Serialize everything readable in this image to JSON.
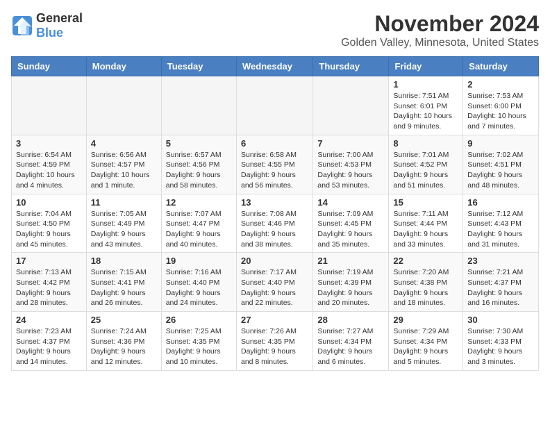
{
  "header": {
    "logo_general": "General",
    "logo_blue": "Blue",
    "month": "November 2024",
    "location": "Golden Valley, Minnesota, United States"
  },
  "weekdays": [
    "Sunday",
    "Monday",
    "Tuesday",
    "Wednesday",
    "Thursday",
    "Friday",
    "Saturday"
  ],
  "weeks": [
    [
      {
        "day": "",
        "info": ""
      },
      {
        "day": "",
        "info": ""
      },
      {
        "day": "",
        "info": ""
      },
      {
        "day": "",
        "info": ""
      },
      {
        "day": "",
        "info": ""
      },
      {
        "day": "1",
        "info": "Sunrise: 7:51 AM\nSunset: 6:01 PM\nDaylight: 10 hours and 9 minutes."
      },
      {
        "day": "2",
        "info": "Sunrise: 7:53 AM\nSunset: 6:00 PM\nDaylight: 10 hours and 7 minutes."
      }
    ],
    [
      {
        "day": "3",
        "info": "Sunrise: 6:54 AM\nSunset: 4:59 PM\nDaylight: 10 hours and 4 minutes."
      },
      {
        "day": "4",
        "info": "Sunrise: 6:56 AM\nSunset: 4:57 PM\nDaylight: 10 hours and 1 minute."
      },
      {
        "day": "5",
        "info": "Sunrise: 6:57 AM\nSunset: 4:56 PM\nDaylight: 9 hours and 58 minutes."
      },
      {
        "day": "6",
        "info": "Sunrise: 6:58 AM\nSunset: 4:55 PM\nDaylight: 9 hours and 56 minutes."
      },
      {
        "day": "7",
        "info": "Sunrise: 7:00 AM\nSunset: 4:53 PM\nDaylight: 9 hours and 53 minutes."
      },
      {
        "day": "8",
        "info": "Sunrise: 7:01 AM\nSunset: 4:52 PM\nDaylight: 9 hours and 51 minutes."
      },
      {
        "day": "9",
        "info": "Sunrise: 7:02 AM\nSunset: 4:51 PM\nDaylight: 9 hours and 48 minutes."
      }
    ],
    [
      {
        "day": "10",
        "info": "Sunrise: 7:04 AM\nSunset: 4:50 PM\nDaylight: 9 hours and 45 minutes."
      },
      {
        "day": "11",
        "info": "Sunrise: 7:05 AM\nSunset: 4:49 PM\nDaylight: 9 hours and 43 minutes."
      },
      {
        "day": "12",
        "info": "Sunrise: 7:07 AM\nSunset: 4:47 PM\nDaylight: 9 hours and 40 minutes."
      },
      {
        "day": "13",
        "info": "Sunrise: 7:08 AM\nSunset: 4:46 PM\nDaylight: 9 hours and 38 minutes."
      },
      {
        "day": "14",
        "info": "Sunrise: 7:09 AM\nSunset: 4:45 PM\nDaylight: 9 hours and 35 minutes."
      },
      {
        "day": "15",
        "info": "Sunrise: 7:11 AM\nSunset: 4:44 PM\nDaylight: 9 hours and 33 minutes."
      },
      {
        "day": "16",
        "info": "Sunrise: 7:12 AM\nSunset: 4:43 PM\nDaylight: 9 hours and 31 minutes."
      }
    ],
    [
      {
        "day": "17",
        "info": "Sunrise: 7:13 AM\nSunset: 4:42 PM\nDaylight: 9 hours and 28 minutes."
      },
      {
        "day": "18",
        "info": "Sunrise: 7:15 AM\nSunset: 4:41 PM\nDaylight: 9 hours and 26 minutes."
      },
      {
        "day": "19",
        "info": "Sunrise: 7:16 AM\nSunset: 4:40 PM\nDaylight: 9 hours and 24 minutes."
      },
      {
        "day": "20",
        "info": "Sunrise: 7:17 AM\nSunset: 4:40 PM\nDaylight: 9 hours and 22 minutes."
      },
      {
        "day": "21",
        "info": "Sunrise: 7:19 AM\nSunset: 4:39 PM\nDaylight: 9 hours and 20 minutes."
      },
      {
        "day": "22",
        "info": "Sunrise: 7:20 AM\nSunset: 4:38 PM\nDaylight: 9 hours and 18 minutes."
      },
      {
        "day": "23",
        "info": "Sunrise: 7:21 AM\nSunset: 4:37 PM\nDaylight: 9 hours and 16 minutes."
      }
    ],
    [
      {
        "day": "24",
        "info": "Sunrise: 7:23 AM\nSunset: 4:37 PM\nDaylight: 9 hours and 14 minutes."
      },
      {
        "day": "25",
        "info": "Sunrise: 7:24 AM\nSunset: 4:36 PM\nDaylight: 9 hours and 12 minutes."
      },
      {
        "day": "26",
        "info": "Sunrise: 7:25 AM\nSunset: 4:35 PM\nDaylight: 9 hours and 10 minutes."
      },
      {
        "day": "27",
        "info": "Sunrise: 7:26 AM\nSunset: 4:35 PM\nDaylight: 9 hours and 8 minutes."
      },
      {
        "day": "28",
        "info": "Sunrise: 7:27 AM\nSunset: 4:34 PM\nDaylight: 9 hours and 6 minutes."
      },
      {
        "day": "29",
        "info": "Sunrise: 7:29 AM\nSunset: 4:34 PM\nDaylight: 9 hours and 5 minutes."
      },
      {
        "day": "30",
        "info": "Sunrise: 7:30 AM\nSunset: 4:33 PM\nDaylight: 9 hours and 3 minutes."
      }
    ]
  ]
}
